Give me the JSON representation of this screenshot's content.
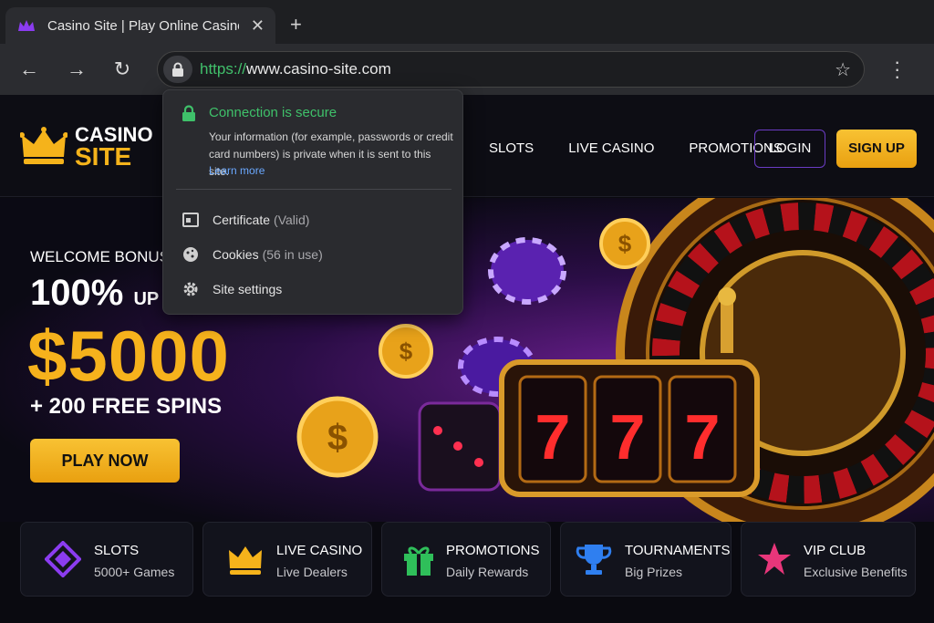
{
  "browser": {
    "tab_title": "Casino Site | Play Online Casino Games",
    "url_scheme": "https://",
    "url_host": "www.casino-site.com"
  },
  "security_popup": {
    "title": "Connection is secure",
    "description": "Your information (for example, passwords or credit card numbers) is private when it is sent to this site.",
    "learn_more": "Learn more",
    "rows": [
      {
        "label": "Certificate",
        "detail": "(Valid)",
        "icon": "certificate-icon"
      },
      {
        "label": "Cookies",
        "detail": "(56 in use)",
        "icon": "cookie-icon"
      },
      {
        "label": "Site settings",
        "detail": "",
        "icon": "gear-icon"
      }
    ]
  },
  "site": {
    "logo_line1": "CASINO",
    "logo_line2": "SITE",
    "nav": [
      "SLOTS",
      "LIVE CASINO",
      "PROMOTIONS"
    ],
    "login": "LOGIN",
    "signup": "SIGN UP"
  },
  "hero": {
    "welcome": "WELCOME BONUS",
    "percent": "100%",
    "up_to": "UP TO",
    "amount": "$5000",
    "spins": "+ 200 FREE SPINS",
    "cta": "PLAY NOW",
    "reel_symbols": [
      "7",
      "7",
      "7"
    ]
  },
  "cards": [
    {
      "title": "SLOTS",
      "subtitle": "5000+ Games",
      "icon": "diamond-icon",
      "color": "#8b3cf0"
    },
    {
      "title": "LIVE CASINO",
      "subtitle": "Live Dealers",
      "icon": "crown-icon",
      "color": "#f5b31b"
    },
    {
      "title": "PROMOTIONS",
      "subtitle": "Daily Rewards",
      "icon": "gift-icon",
      "color": "#2fbf5a"
    },
    {
      "title": "TOURNAMENTS",
      "subtitle": "Big Prizes",
      "icon": "trophy-icon",
      "color": "#2f7ff0"
    },
    {
      "title": "VIP CLUB",
      "subtitle": "Exclusive Benefits",
      "icon": "star-icon",
      "color": "#e8367a"
    }
  ],
  "colors": {
    "accent_gold": "#f5b31b",
    "accent_purple": "#6a3cc4",
    "secure_green": "#3fc16a"
  }
}
